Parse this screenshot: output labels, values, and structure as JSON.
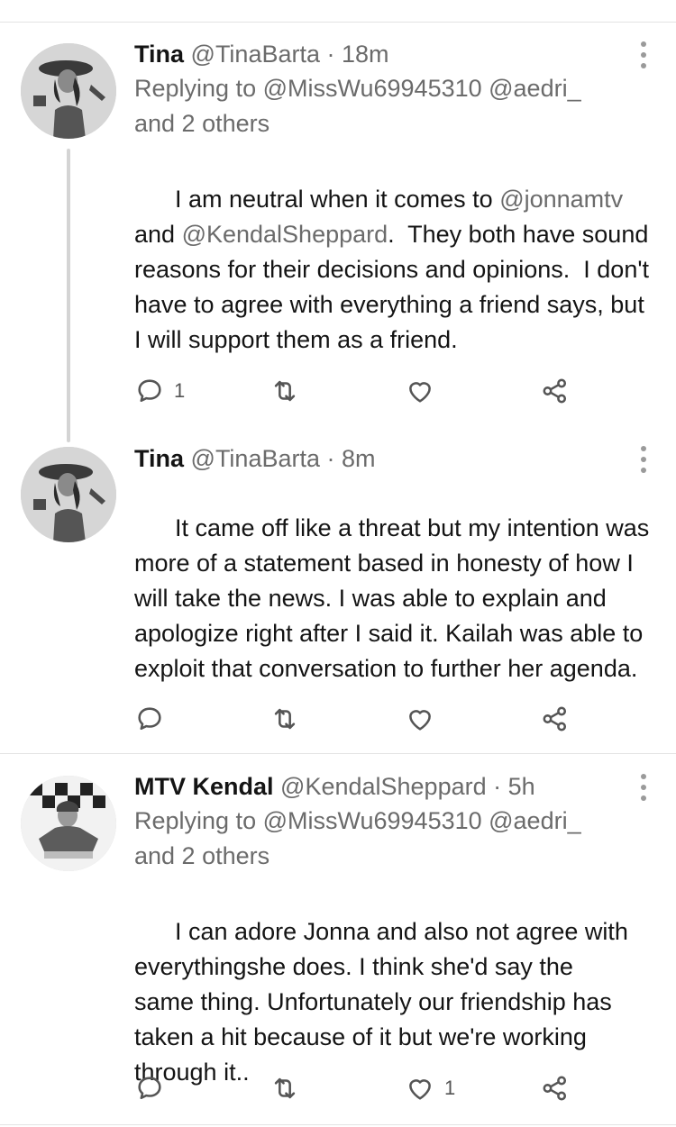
{
  "tweets": [
    {
      "name": "Tina",
      "handle": "@TinaBarta",
      "time": "· 18m",
      "reply_prefix": "Replying to ",
      "reply_to": "@MissWu69945310 @aedri_",
      "reply_others": "and 2 others",
      "body": [
        {
          "t": "I am neutral when it comes to "
        },
        {
          "t": "@jonnamtv",
          "m": true
        },
        {
          "t": "\nand "
        },
        {
          "t": "@KendalSheppard",
          "m": true
        },
        {
          "t": ".  They both have sound reasons for their decisions and opinions.  I don't have to agree with everything a friend says, but I will support them as a friend."
        }
      ],
      "reply_count": "1",
      "retweet_count": "",
      "like_count": ""
    },
    {
      "name": "Tina",
      "handle": "@TinaBarta",
      "time": "· 8m",
      "body": [
        {
          "t": "It came off like a threat but my intention was more of a statement based in honesty of how I will take the news. I was able to explain and apologize right after I said it. Kailah was able to exploit that conversation to further her agenda."
        }
      ],
      "reply_count": "",
      "retweet_count": "",
      "like_count": ""
    },
    {
      "name": "MTV Kendal",
      "handle": "@KendalSheppard",
      "time": "· 5h",
      "reply_prefix": "Replying to ",
      "reply_to": "@MissWu69945310 @aedri_",
      "reply_others": "and 2 others",
      "body": [
        {
          "t": "I can adore Jonna and also not agree with everythingshe does. I think she'd say the same thing. Unfortunately our friendship has taken a hit because of it but we're working through it.."
        }
      ],
      "reply_count": "",
      "retweet_count": "",
      "like_count": "1"
    }
  ],
  "icons": {
    "reply": "speech-bubble-icon",
    "retweet": "retweet-icon",
    "like": "heart-icon",
    "share": "share-icon",
    "more": "more-vertical-icon"
  },
  "colors": {
    "text": "#141414",
    "muted": "#6b6b6b",
    "icon": "#555555",
    "divider": "#e3e3e3"
  }
}
